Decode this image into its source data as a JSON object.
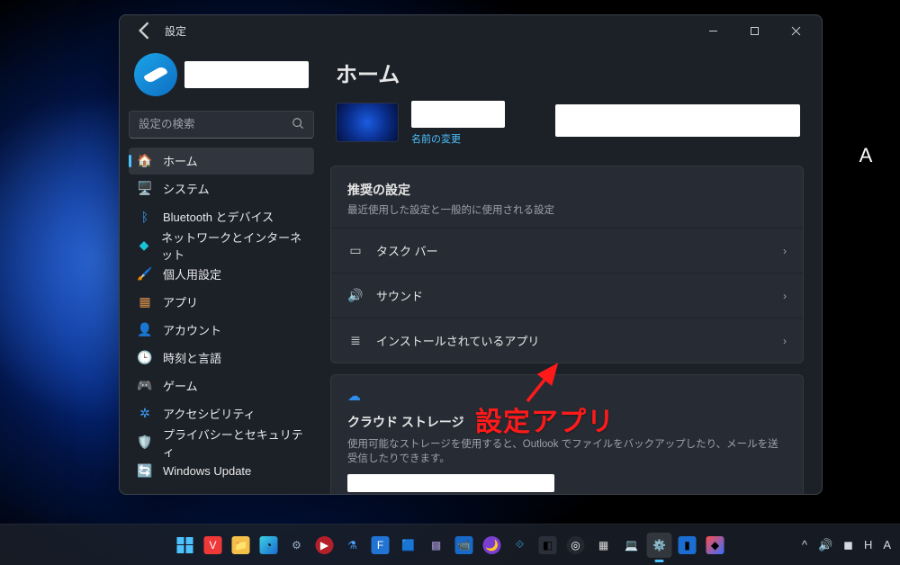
{
  "app": {
    "title": "設定"
  },
  "search": {
    "placeholder": "設定の検索"
  },
  "page": {
    "title": "ホーム",
    "rename": "名前の変更"
  },
  "nav": [
    {
      "label": "ホーム",
      "icon": "🏠",
      "active": true,
      "name": "nav-home"
    },
    {
      "label": "システム",
      "icon": "🖥️",
      "active": false,
      "name": "nav-system"
    },
    {
      "label": "Bluetooth とデバイス",
      "icon": "ᛒ",
      "active": false,
      "name": "nav-bluetooth",
      "iconColor": "#3aa0ff"
    },
    {
      "label": "ネットワークとインターネット",
      "icon": "◆",
      "active": false,
      "name": "nav-network",
      "iconColor": "#19c3d6"
    },
    {
      "label": "個人用設定",
      "icon": "🖌️",
      "active": false,
      "name": "nav-personalization"
    },
    {
      "label": "アプリ",
      "icon": "▦",
      "active": false,
      "name": "nav-apps",
      "iconColor": "#d98f4a"
    },
    {
      "label": "アカウント",
      "icon": "👤",
      "active": false,
      "name": "nav-accounts",
      "iconColor": "#1fb5c9"
    },
    {
      "label": "時刻と言語",
      "icon": "🕒",
      "active": false,
      "name": "nav-time-language"
    },
    {
      "label": "ゲーム",
      "icon": "🎮",
      "active": false,
      "name": "nav-gaming",
      "iconColor": "#bfc6d1"
    },
    {
      "label": "アクセシビリティ",
      "icon": "✲",
      "active": false,
      "name": "nav-accessibility",
      "iconColor": "#3aa0ff"
    },
    {
      "label": "プライバシーとセキュリティ",
      "icon": "🛡️",
      "active": false,
      "name": "nav-privacy"
    },
    {
      "label": "Windows Update",
      "icon": "🔄",
      "active": false,
      "name": "nav-update",
      "iconColor": "#1fa3d8"
    }
  ],
  "recommended": {
    "title": "推奨の設定",
    "subtitle": "最近使用した設定と一般的に使用される設定",
    "items": [
      {
        "label": "タスク バー",
        "icon": "▭",
        "name": "rec-taskbar"
      },
      {
        "label": "サウンド",
        "icon": "🔊",
        "name": "rec-sound"
      },
      {
        "label": "インストールされているアプリ",
        "icon": "≣",
        "name": "rec-installed-apps"
      }
    ]
  },
  "cloud": {
    "title": "クラウド ストレージ",
    "desc": "使用可能なストレージを使用すると、Outlook でファイルをバックアップしたり、メールを送受信したりできます。"
  },
  "annotation": {
    "text": "設定アプリ"
  },
  "desktop": {
    "icon_label": "A"
  }
}
